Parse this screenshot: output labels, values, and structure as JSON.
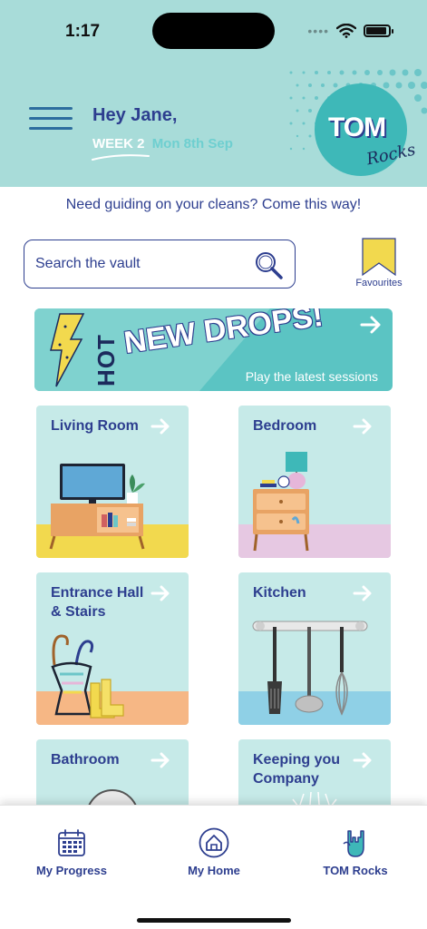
{
  "status_bar": {
    "time": "1:17"
  },
  "header": {
    "greeting": "Hey Jane,",
    "week_label": "WEEK 2",
    "week_date": "Mon 8th Sep",
    "logo_main": "TOM",
    "logo_sub": "Rocks"
  },
  "guide_text": "Need guiding on your cleans? Come this way!",
  "search": {
    "placeholder": "Search the vault"
  },
  "favourites": {
    "label": "Favourites"
  },
  "hot_banner": {
    "hot": "HOT",
    "title": "NEW DROPS!",
    "subtitle": "Play the latest sessions"
  },
  "rooms": [
    {
      "label": "Living Room"
    },
    {
      "label": "Bedroom"
    },
    {
      "label": "Entrance Hall & Stairs"
    },
    {
      "label": "Kitchen"
    },
    {
      "label": "Bathroom"
    },
    {
      "label": "Keeping you Company"
    }
  ],
  "bottom_nav": {
    "items": [
      {
        "label": "My Progress",
        "icon": "calendar-icon"
      },
      {
        "label": "My Home",
        "icon": "home-icon"
      },
      {
        "label": "TOM Rocks",
        "icon": "rock-hand-icon"
      }
    ]
  },
  "colors": {
    "header_bg": "#a8dcd9",
    "primary": "#2d3e8f",
    "card_bg": "#c6eae8",
    "banner_bg": "#5bc4c3",
    "accent_yellow": "#f2d94e"
  }
}
